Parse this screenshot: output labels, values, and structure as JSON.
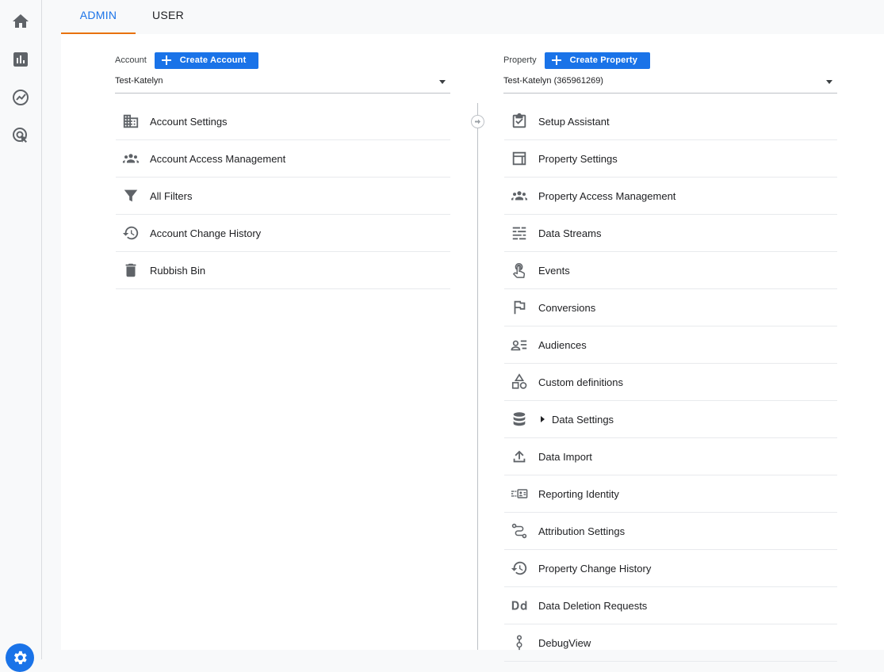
{
  "tabs": {
    "admin": "ADMIN",
    "user": "USER"
  },
  "account": {
    "label": "Account",
    "create_label": "Create Account",
    "selected": "Test-Katelyn",
    "items": [
      {
        "label": "Account Settings",
        "icon": "building-icon"
      },
      {
        "label": "Account Access Management",
        "icon": "people-icon"
      },
      {
        "label": "All Filters",
        "icon": "filter-icon"
      },
      {
        "label": "Account Change History",
        "icon": "history-icon"
      },
      {
        "label": "Rubbish Bin",
        "icon": "trash-icon"
      }
    ]
  },
  "property": {
    "label": "Property",
    "create_label": "Create Property",
    "selected": "Test-Katelyn (365961269)",
    "items": [
      {
        "label": "Setup Assistant",
        "icon": "checklist-icon"
      },
      {
        "label": "Property Settings",
        "icon": "layout-icon"
      },
      {
        "label": "Property Access Management",
        "icon": "people-icon"
      },
      {
        "label": "Data Streams",
        "icon": "streams-icon"
      },
      {
        "label": "Events",
        "icon": "touch-icon"
      },
      {
        "label": "Conversions",
        "icon": "flag-icon"
      },
      {
        "label": "Audiences",
        "icon": "audience-icon"
      },
      {
        "label": "Custom definitions",
        "icon": "shapes-icon"
      },
      {
        "label": "Data Settings",
        "icon": "database-icon"
      },
      {
        "label": "Data Import",
        "icon": "upload-icon"
      },
      {
        "label": "Reporting Identity",
        "icon": "identity-icon"
      },
      {
        "label": "Attribution Settings",
        "icon": "attribution-icon"
      },
      {
        "label": "Property Change History",
        "icon": "history-icon"
      },
      {
        "label": "Data Deletion Requests",
        "icon": "dd-icon"
      },
      {
        "label": "DebugView",
        "icon": "debug-icon"
      }
    ]
  },
  "colors": {
    "accent": "#1a73e8",
    "tab_underline": "#e8710a",
    "icon": "#5f6368"
  }
}
